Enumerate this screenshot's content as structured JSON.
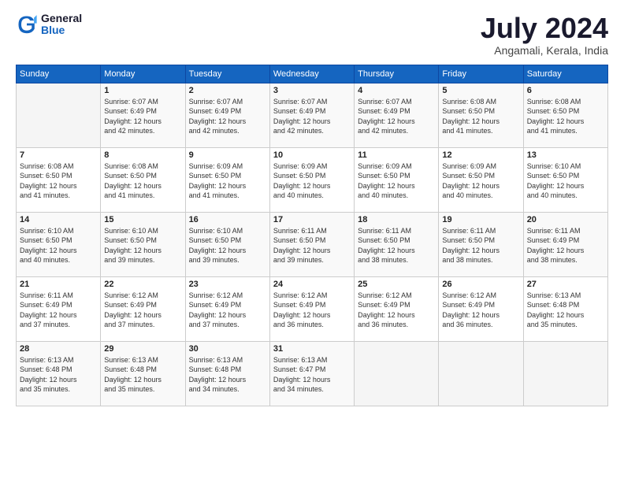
{
  "logo": {
    "general": "General",
    "blue": "Blue"
  },
  "title": "July 2024",
  "location": "Angamali, Kerala, India",
  "days_of_week": [
    "Sunday",
    "Monday",
    "Tuesday",
    "Wednesday",
    "Thursday",
    "Friday",
    "Saturday"
  ],
  "weeks": [
    [
      {
        "day": "",
        "info": ""
      },
      {
        "day": "1",
        "info": "Sunrise: 6:07 AM\nSunset: 6:49 PM\nDaylight: 12 hours\nand 42 minutes."
      },
      {
        "day": "2",
        "info": "Sunrise: 6:07 AM\nSunset: 6:49 PM\nDaylight: 12 hours\nand 42 minutes."
      },
      {
        "day": "3",
        "info": "Sunrise: 6:07 AM\nSunset: 6:49 PM\nDaylight: 12 hours\nand 42 minutes."
      },
      {
        "day": "4",
        "info": "Sunrise: 6:07 AM\nSunset: 6:49 PM\nDaylight: 12 hours\nand 42 minutes."
      },
      {
        "day": "5",
        "info": "Sunrise: 6:08 AM\nSunset: 6:50 PM\nDaylight: 12 hours\nand 41 minutes."
      },
      {
        "day": "6",
        "info": "Sunrise: 6:08 AM\nSunset: 6:50 PM\nDaylight: 12 hours\nand 41 minutes."
      }
    ],
    [
      {
        "day": "7",
        "info": "Sunrise: 6:08 AM\nSunset: 6:50 PM\nDaylight: 12 hours\nand 41 minutes."
      },
      {
        "day": "8",
        "info": "Sunrise: 6:08 AM\nSunset: 6:50 PM\nDaylight: 12 hours\nand 41 minutes."
      },
      {
        "day": "9",
        "info": "Sunrise: 6:09 AM\nSunset: 6:50 PM\nDaylight: 12 hours\nand 41 minutes."
      },
      {
        "day": "10",
        "info": "Sunrise: 6:09 AM\nSunset: 6:50 PM\nDaylight: 12 hours\nand 40 minutes."
      },
      {
        "day": "11",
        "info": "Sunrise: 6:09 AM\nSunset: 6:50 PM\nDaylight: 12 hours\nand 40 minutes."
      },
      {
        "day": "12",
        "info": "Sunrise: 6:09 AM\nSunset: 6:50 PM\nDaylight: 12 hours\nand 40 minutes."
      },
      {
        "day": "13",
        "info": "Sunrise: 6:10 AM\nSunset: 6:50 PM\nDaylight: 12 hours\nand 40 minutes."
      }
    ],
    [
      {
        "day": "14",
        "info": "Sunrise: 6:10 AM\nSunset: 6:50 PM\nDaylight: 12 hours\nand 40 minutes."
      },
      {
        "day": "15",
        "info": "Sunrise: 6:10 AM\nSunset: 6:50 PM\nDaylight: 12 hours\nand 39 minutes."
      },
      {
        "day": "16",
        "info": "Sunrise: 6:10 AM\nSunset: 6:50 PM\nDaylight: 12 hours\nand 39 minutes."
      },
      {
        "day": "17",
        "info": "Sunrise: 6:11 AM\nSunset: 6:50 PM\nDaylight: 12 hours\nand 39 minutes."
      },
      {
        "day": "18",
        "info": "Sunrise: 6:11 AM\nSunset: 6:50 PM\nDaylight: 12 hours\nand 38 minutes."
      },
      {
        "day": "19",
        "info": "Sunrise: 6:11 AM\nSunset: 6:50 PM\nDaylight: 12 hours\nand 38 minutes."
      },
      {
        "day": "20",
        "info": "Sunrise: 6:11 AM\nSunset: 6:49 PM\nDaylight: 12 hours\nand 38 minutes."
      }
    ],
    [
      {
        "day": "21",
        "info": "Sunrise: 6:11 AM\nSunset: 6:49 PM\nDaylight: 12 hours\nand 37 minutes."
      },
      {
        "day": "22",
        "info": "Sunrise: 6:12 AM\nSunset: 6:49 PM\nDaylight: 12 hours\nand 37 minutes."
      },
      {
        "day": "23",
        "info": "Sunrise: 6:12 AM\nSunset: 6:49 PM\nDaylight: 12 hours\nand 37 minutes."
      },
      {
        "day": "24",
        "info": "Sunrise: 6:12 AM\nSunset: 6:49 PM\nDaylight: 12 hours\nand 36 minutes."
      },
      {
        "day": "25",
        "info": "Sunrise: 6:12 AM\nSunset: 6:49 PM\nDaylight: 12 hours\nand 36 minutes."
      },
      {
        "day": "26",
        "info": "Sunrise: 6:12 AM\nSunset: 6:49 PM\nDaylight: 12 hours\nand 36 minutes."
      },
      {
        "day": "27",
        "info": "Sunrise: 6:13 AM\nSunset: 6:48 PM\nDaylight: 12 hours\nand 35 minutes."
      }
    ],
    [
      {
        "day": "28",
        "info": "Sunrise: 6:13 AM\nSunset: 6:48 PM\nDaylight: 12 hours\nand 35 minutes."
      },
      {
        "day": "29",
        "info": "Sunrise: 6:13 AM\nSunset: 6:48 PM\nDaylight: 12 hours\nand 35 minutes."
      },
      {
        "day": "30",
        "info": "Sunrise: 6:13 AM\nSunset: 6:48 PM\nDaylight: 12 hours\nand 34 minutes."
      },
      {
        "day": "31",
        "info": "Sunrise: 6:13 AM\nSunset: 6:47 PM\nDaylight: 12 hours\nand 34 minutes."
      },
      {
        "day": "",
        "info": ""
      },
      {
        "day": "",
        "info": ""
      },
      {
        "day": "",
        "info": ""
      }
    ]
  ]
}
